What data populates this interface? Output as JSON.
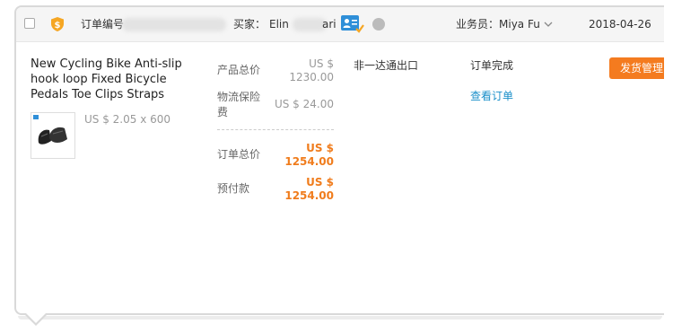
{
  "header": {
    "order_no_label": "订单编号",
    "buyer_label": "买家：",
    "buyer_name_start": "Elin",
    "buyer_name_end": "ari",
    "salesperson": "业务员：Miya Fu",
    "date": "2018-04-26"
  },
  "product": {
    "title": "New Cycling Bike Anti-slip hook loop Fixed Bicycle Pedals Toe Clips Straps",
    "unit_price_qty": "US $ 2.05 x 600"
  },
  "pricing": {
    "product_total_label": "产品总价",
    "product_total_currency": "US $",
    "product_total_amount": "1230.00",
    "insurance_label": "物流保险费",
    "insurance_value": "US $ 24.00",
    "order_total_label": "订单总价",
    "order_total_currency": "US $",
    "order_total_amount": "1254.00",
    "prepaid_label": "预付款",
    "prepaid_currency": "US $",
    "prepaid_amount": "1254.00"
  },
  "shipping_method": "非一达通出口",
  "order_status": "订单完成",
  "view_order_link": "查看订单",
  "action_button": "发货管理",
  "colors": {
    "accent_orange": "#f47b1f",
    "link_blue": "#1a8fc9",
    "shield_orange": "#f5a623"
  },
  "icons": {
    "shield": "shield-icon",
    "contact": "contact-card-icon",
    "chevron": "chevron-down-icon"
  }
}
